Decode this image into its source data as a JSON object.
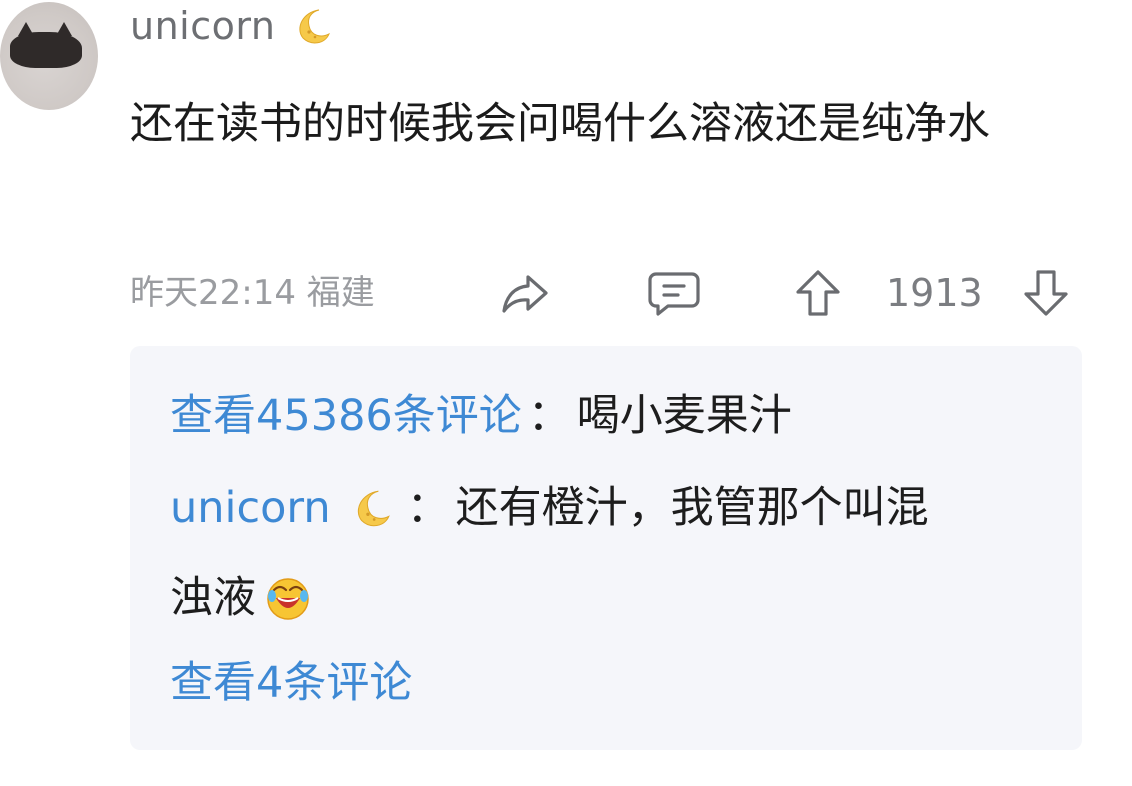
{
  "post": {
    "username": "unicorn",
    "text": "还在读书的时候我会问喝什么溶液还是纯净水",
    "time_location": "昨天22:14 福建",
    "vote_count": "1913"
  },
  "replies": {
    "view_all_prefix": "查看45386条评论",
    "reply1_text": "喝小麦果汁",
    "reply2_user": "unicorn",
    "reply2_text_a": "还有橙汁，我管那个叫混",
    "reply2_text_b": "浊液",
    "view_more": "查看4条评论",
    "separator": "："
  },
  "icons": [
    "moon-emoji-icon",
    "share-icon",
    "comment-icon",
    "upvote-icon",
    "downvote-icon",
    "laughing-emoji-icon"
  ],
  "colors": {
    "link": "#3e89d4",
    "meta": "#9a9ca0",
    "box_bg": "#f5f6fa"
  }
}
